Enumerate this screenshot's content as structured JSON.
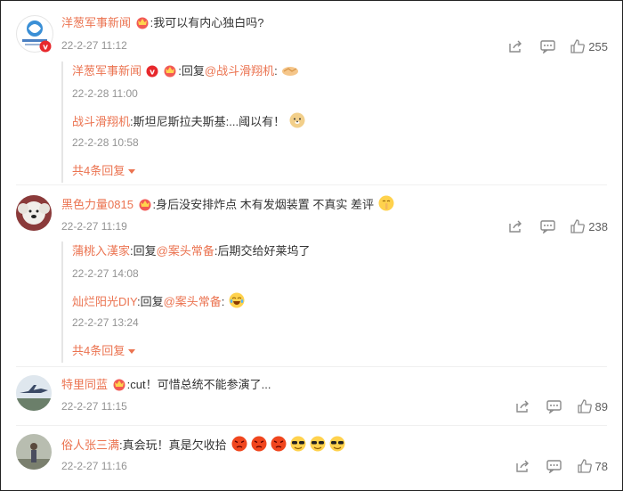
{
  "comments": [
    {
      "user": "洋葱军事新闻",
      "text": ":我可以有内心独白吗?",
      "time": "22-2-27 11:12",
      "likes": "255",
      "replies": [
        {
          "user": "洋葱军事新闻",
          "prefix": ":回复",
          "mention": "@战斗滑翔机",
          "text": ":",
          "time": "22-2-28 11:00"
        },
        {
          "user": "战斗滑翔机",
          "prefix": "",
          "mention": "",
          "text": ":斯坦尼斯拉夫斯基:...阈以有！",
          "time": "22-2-28 10:58"
        }
      ],
      "more": "共4条回复"
    },
    {
      "user": "黑色力量0815",
      "text": ":身后没安排炸点 木有发烟装置 不真实 差评",
      "time": "22-2-27 11:19",
      "likes": "238",
      "replies": [
        {
          "user": "蒲桃入漢家",
          "prefix": ":回复",
          "mention": "@案头常备",
          "text": ":后期交给好莱坞了",
          "time": "22-2-27 14:08"
        },
        {
          "user": "灿烂阳光DIY",
          "prefix": ":回复",
          "mention": "@案头常备",
          "text": ":",
          "time": "22-2-27 13:24"
        }
      ],
      "more": "共4条回复"
    },
    {
      "user": "特里同蓝",
      "text": ":cut！可惜总统不能参演了...",
      "time": "22-2-27 11:15",
      "likes": "89",
      "replies": [],
      "more": ""
    },
    {
      "user": "俗人张三满",
      "text": ":真会玩！真是欠收拾",
      "time": "22-2-27 11:16",
      "likes": "78",
      "replies": [],
      "more": ""
    }
  ],
  "icons": {
    "share": "share-icon",
    "comment": "comment-icon",
    "like": "thumbs-up-icon"
  },
  "colors": {
    "username": "#eb7350",
    "time": "#939393"
  }
}
